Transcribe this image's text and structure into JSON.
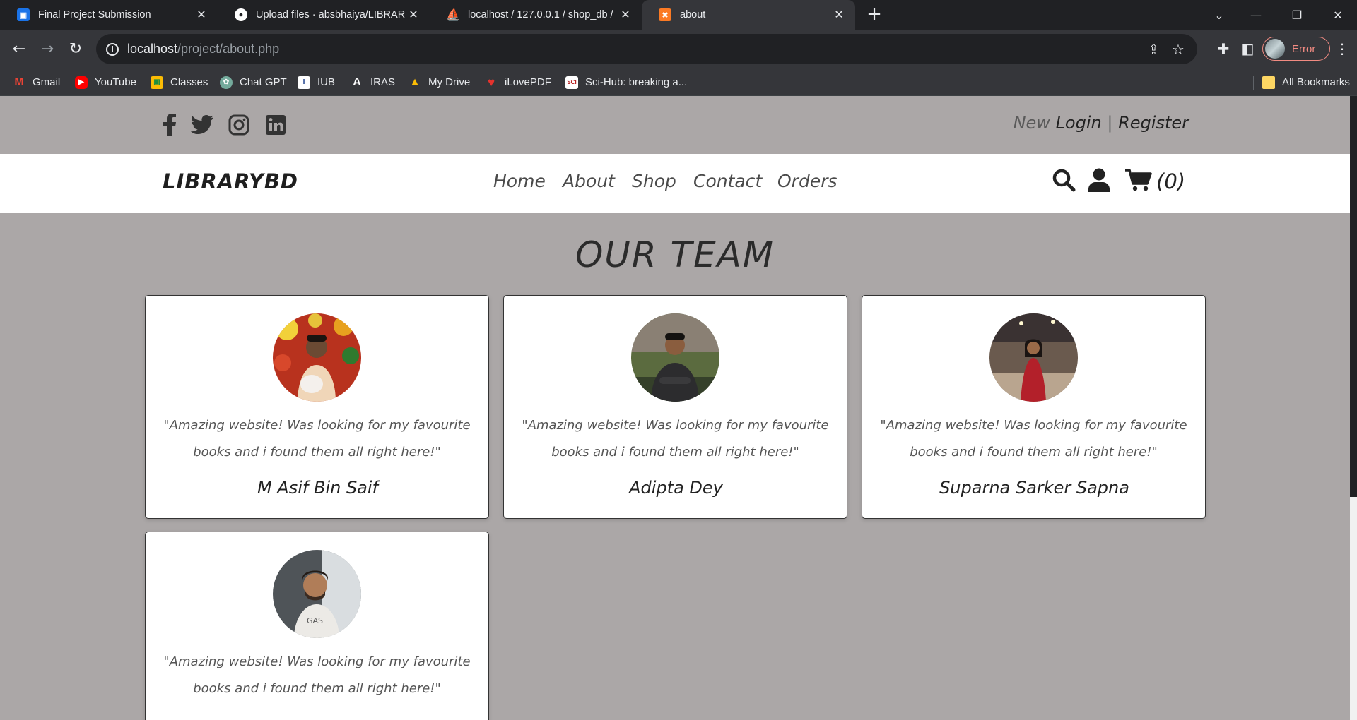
{
  "browser": {
    "tabs": [
      {
        "title": "Final Project Submission",
        "favicon": "classroom-icon",
        "color": "#1a73e8",
        "active": false
      },
      {
        "title": "Upload files · absbhaiya/LIBRAR",
        "favicon": "github-icon",
        "color": "#ffffff",
        "active": false
      },
      {
        "title": "localhost / 127.0.0.1 / shop_db /",
        "favicon": "phpmyadmin-icon",
        "color": "#f29111",
        "active": false
      },
      {
        "title": "about",
        "favicon": "xampp-icon",
        "color": "#fb7a24",
        "active": true
      }
    ],
    "url_host": "localhost",
    "url_path": "/project/about.php",
    "profile_status": "Error",
    "bookmarks": [
      {
        "label": "Gmail",
        "icon": "gmail-icon",
        "color": "#ea4335"
      },
      {
        "label": "YouTube",
        "icon": "youtube-icon",
        "color": "#ff0000"
      },
      {
        "label": "Classes",
        "icon": "classroom-icon",
        "color": "#fbbc04"
      },
      {
        "label": "Chat GPT",
        "icon": "chatgpt-icon",
        "color": "#74aa9c"
      },
      {
        "label": "IUB",
        "icon": "iub-icon",
        "color": "#ffffff"
      },
      {
        "label": "IRAS",
        "icon": "iras-icon",
        "color": "#202124"
      },
      {
        "label": "My Drive",
        "icon": "drive-icon",
        "color": "#1fa463"
      },
      {
        "label": "iLovePDF",
        "icon": "ilovepdf-icon",
        "color": "#e5322d"
      },
      {
        "label": "Sci-Hub: breaking a...",
        "icon": "scihub-icon",
        "color": "#ffffff"
      }
    ],
    "all_bookmarks": "All Bookmarks"
  },
  "site": {
    "header": {
      "social": [
        "facebook-icon",
        "twitter-icon",
        "instagram-icon",
        "linkedin-icon"
      ],
      "auth_new": "New",
      "auth_login": "Login",
      "auth_sep": "|",
      "auth_register": "Register"
    },
    "nav": {
      "logo": "LIBRARYBD",
      "links": [
        "Home",
        "About",
        "Shop",
        "Contact",
        "Orders"
      ],
      "cart_count": "(0)"
    },
    "heading": "OUR TEAM",
    "team": [
      {
        "name": "M Asif Bin Saif",
        "quote": "\"Amazing website! Was looking for my favourite books and i found them all right here!\""
      },
      {
        "name": "Adipta Dey",
        "quote": "\"Amazing website! Was looking for my favourite books and i found them all right here!\""
      },
      {
        "name": "Suparna Sarker Sapna",
        "quote": "\"Amazing website! Was looking for my favourite books and i found them all right here!\""
      },
      {
        "name": "",
        "quote": "\"Amazing website! Was looking for my favourite books and i found them all right here!\""
      }
    ]
  },
  "colors": {
    "page_bg": "#aba7a7",
    "chrome_dark": "#202124",
    "chrome_toolbar": "#35363a",
    "text_dark": "#222222"
  }
}
